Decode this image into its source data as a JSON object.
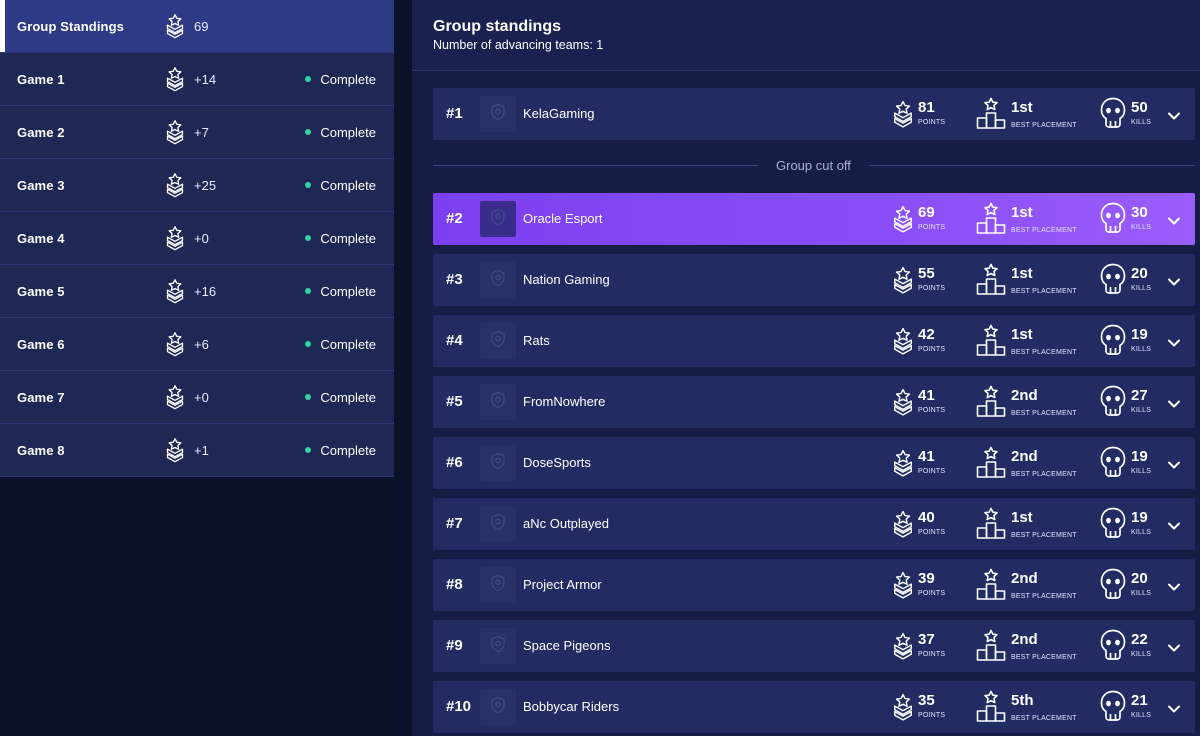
{
  "colors": {
    "status_complete": "#2fd6a0",
    "highlight": "#8a4ef7"
  },
  "sidebar": {
    "items": [
      {
        "label": "Group Standings",
        "value": "69",
        "status": "",
        "active": true
      },
      {
        "label": "Game 1",
        "value": "+14",
        "status": "Complete",
        "active": false
      },
      {
        "label": "Game 2",
        "value": "+7",
        "status": "Complete",
        "active": false
      },
      {
        "label": "Game 3",
        "value": "+25",
        "status": "Complete",
        "active": false
      },
      {
        "label": "Game 4",
        "value": "+0",
        "status": "Complete",
        "active": false
      },
      {
        "label": "Game 5",
        "value": "+16",
        "status": "Complete",
        "active": false
      },
      {
        "label": "Game 6",
        "value": "+6",
        "status": "Complete",
        "active": false
      },
      {
        "label": "Game 7",
        "value": "+0",
        "status": "Complete",
        "active": false
      },
      {
        "label": "Game 8",
        "value": "+1",
        "status": "Complete",
        "active": false
      }
    ]
  },
  "main": {
    "title": "Group standings",
    "subtitle": "Number of advancing teams: 1",
    "cutoff_label": "Group cut off",
    "stat_labels": {
      "points": "POINTS",
      "best_placement": "BEST PLACEMENT",
      "kills": "KILLS"
    },
    "teams": [
      {
        "rank": "#1",
        "name": "KelaGaming",
        "points": "81",
        "best_placement": "1st",
        "kills": "50",
        "highlight": false
      },
      {
        "rank": "#2",
        "name": "Oracle Esport",
        "points": "69",
        "best_placement": "1st",
        "kills": "30",
        "highlight": true
      },
      {
        "rank": "#3",
        "name": "Nation Gaming",
        "points": "55",
        "best_placement": "1st",
        "kills": "20",
        "highlight": false
      },
      {
        "rank": "#4",
        "name": "Rats",
        "points": "42",
        "best_placement": "1st",
        "kills": "19",
        "highlight": false
      },
      {
        "rank": "#5",
        "name": "FromNowhere",
        "points": "41",
        "best_placement": "2nd",
        "kills": "27",
        "highlight": false
      },
      {
        "rank": "#6",
        "name": "DoseSports",
        "points": "41",
        "best_placement": "2nd",
        "kills": "19",
        "highlight": false
      },
      {
        "rank": "#7",
        "name": "aNc Outplayed",
        "points": "40",
        "best_placement": "1st",
        "kills": "19",
        "highlight": false
      },
      {
        "rank": "#8",
        "name": "Project Armor",
        "points": "39",
        "best_placement": "2nd",
        "kills": "20",
        "highlight": false
      },
      {
        "rank": "#9",
        "name": "Space Pigeons",
        "points": "37",
        "best_placement": "2nd",
        "kills": "22",
        "highlight": false
      },
      {
        "rank": "#10",
        "name": "Bobbycar Riders",
        "points": "35",
        "best_placement": "5th",
        "kills": "21",
        "highlight": false
      }
    ]
  }
}
